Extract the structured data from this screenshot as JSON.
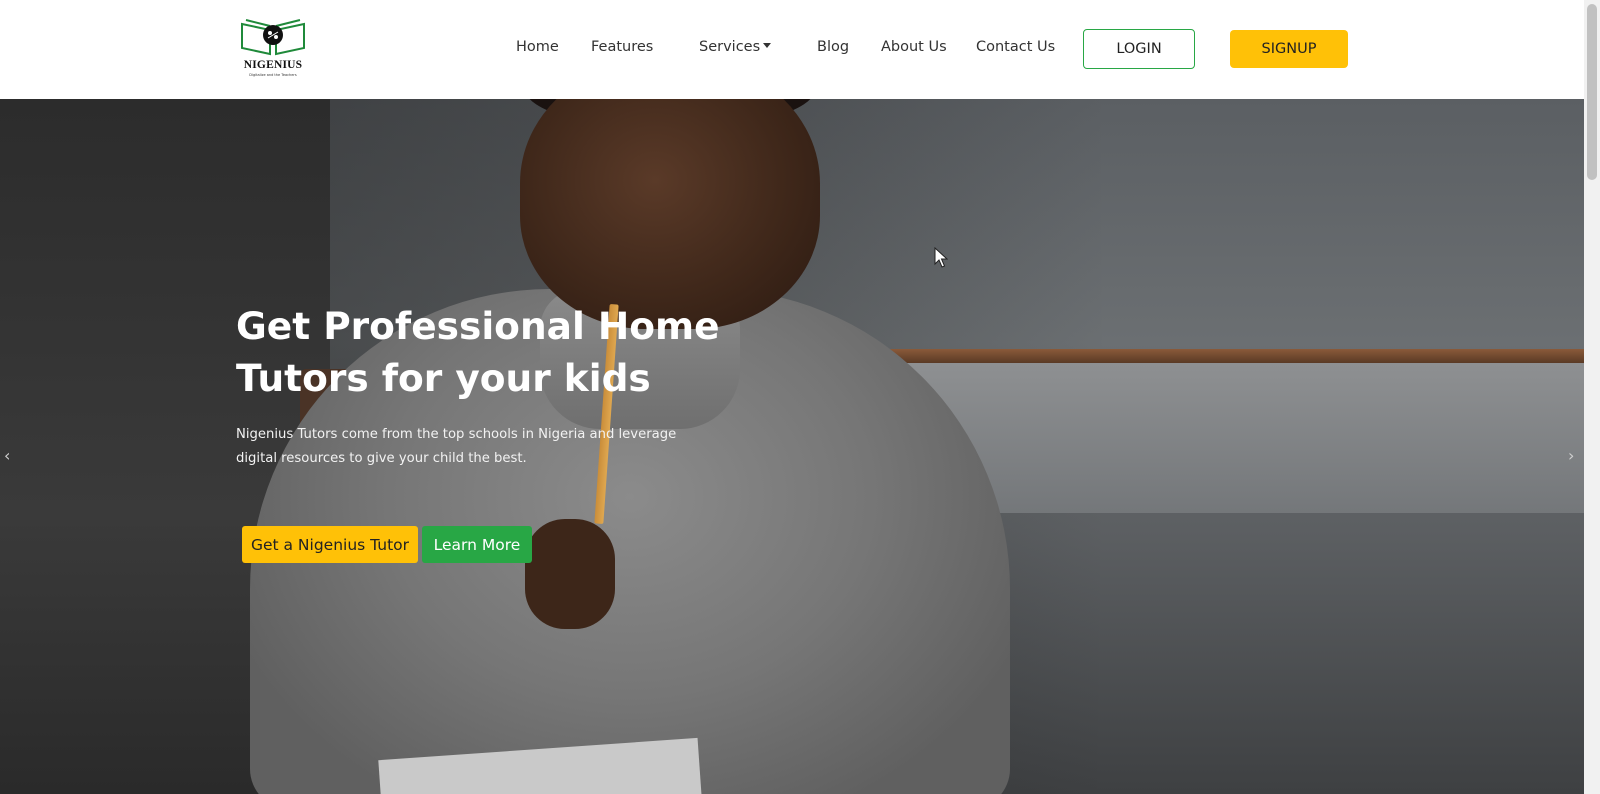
{
  "brand": {
    "name": "NIGENIUS",
    "tagline": "Digitalize and the Teachers"
  },
  "nav": {
    "items": [
      {
        "label": "Home"
      },
      {
        "label": "Features"
      },
      {
        "label": "Services"
      },
      {
        "label": "Blog"
      },
      {
        "label": "About Us"
      },
      {
        "label": "Contact Us"
      }
    ],
    "login_label": "LOGIN",
    "signup_label": "SIGNUP"
  },
  "hero": {
    "title": "Get Professional Home Tutors for your kids",
    "subtitle": "Nigenius Tutors come from the top schools in Nigeria and leverage digital resources to give your child the best.",
    "primary_cta": "Get a Nigenius Tutor",
    "secondary_cta": "Learn More",
    "prev_icon": "‹",
    "next_icon": "›"
  },
  "colors": {
    "accent_yellow": "#ffc107",
    "accent_green": "#28a745"
  }
}
